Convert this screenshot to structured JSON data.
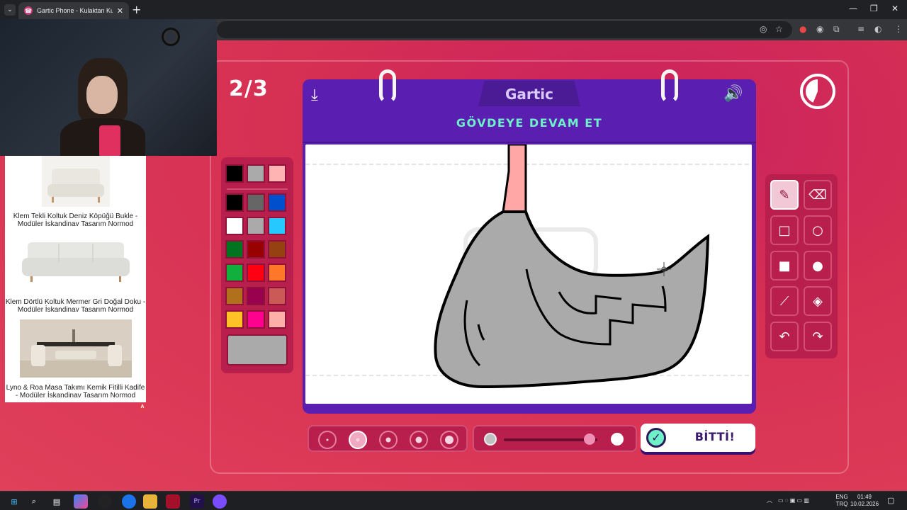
{
  "browser": {
    "tab_title": "Gartic Phone - Kulaktan Kulağa",
    "tab_close": "✕",
    "new_tab": "+",
    "tab_list": "⌄",
    "window": {
      "minimize": "—",
      "restore": "❐",
      "close": "✕"
    }
  },
  "game": {
    "round_counter": "2/3",
    "logo_text": "Gartic",
    "instruction": "GÖVDEYE DEVAM ET",
    "done_label": "BİTTİ!",
    "done_check": "✓",
    "download_icon": "⤓",
    "sound_icon": "🔊",
    "timer_elapsed_fraction": 0.56
  },
  "palette": {
    "recent": [
      "#000000",
      "#aaaaaa",
      "#ffb4b4"
    ],
    "colors": [
      "#000000",
      "#666666",
      "#0050cd",
      "#ffffff",
      "#aaaaaa",
      "#26c9ff",
      "#017420",
      "#990000",
      "#964112",
      "#11b03c",
      "#ff0013",
      "#ff7829",
      "#b0701c",
      "#99004e",
      "#cb5a57",
      "#ffc126",
      "#ff008f",
      "#feafa8"
    ],
    "selected_color": "#aaaaaa"
  },
  "tools": {
    "items": [
      {
        "name": "pencil",
        "glyph": "✎"
      },
      {
        "name": "eraser",
        "glyph": "⌫"
      },
      {
        "name": "rectangle-outline",
        "glyph": "□"
      },
      {
        "name": "ellipse-outline",
        "glyph": "○"
      },
      {
        "name": "rectangle-filled",
        "glyph": "■"
      },
      {
        "name": "ellipse-filled",
        "glyph": "●"
      },
      {
        "name": "line",
        "glyph": "⟋"
      },
      {
        "name": "fill-bucket",
        "glyph": "◈"
      },
      {
        "name": "undo",
        "glyph": "↶"
      },
      {
        "name": "redo",
        "glyph": "↷"
      }
    ],
    "active": "pencil"
  },
  "brush": {
    "sizes": [
      "xs",
      "s",
      "m",
      "l",
      "xl"
    ],
    "selected_size": "s",
    "opacity_level": 0.92
  },
  "ads": [
    {
      "caption": "Klem Tekli Koltuk Deniz Köpüğü Bukle - Modüler İskandinav Tasarım Normod"
    },
    {
      "caption": "Klem Dörtlü Koltuk Mermer Gri Doğal Doku - Modüler İskandinav Tasarım Normod"
    },
    {
      "caption": "Lyno & Roa Masa Takımı Kemik Fitilli Kadife - Modüler İskandinav Tasarım Normod"
    }
  ],
  "ad_badge": "A",
  "taskbar": {
    "lang": "ENG",
    "lang2": "TRQ",
    "time": "01:49",
    "date": "10.02.2026"
  }
}
